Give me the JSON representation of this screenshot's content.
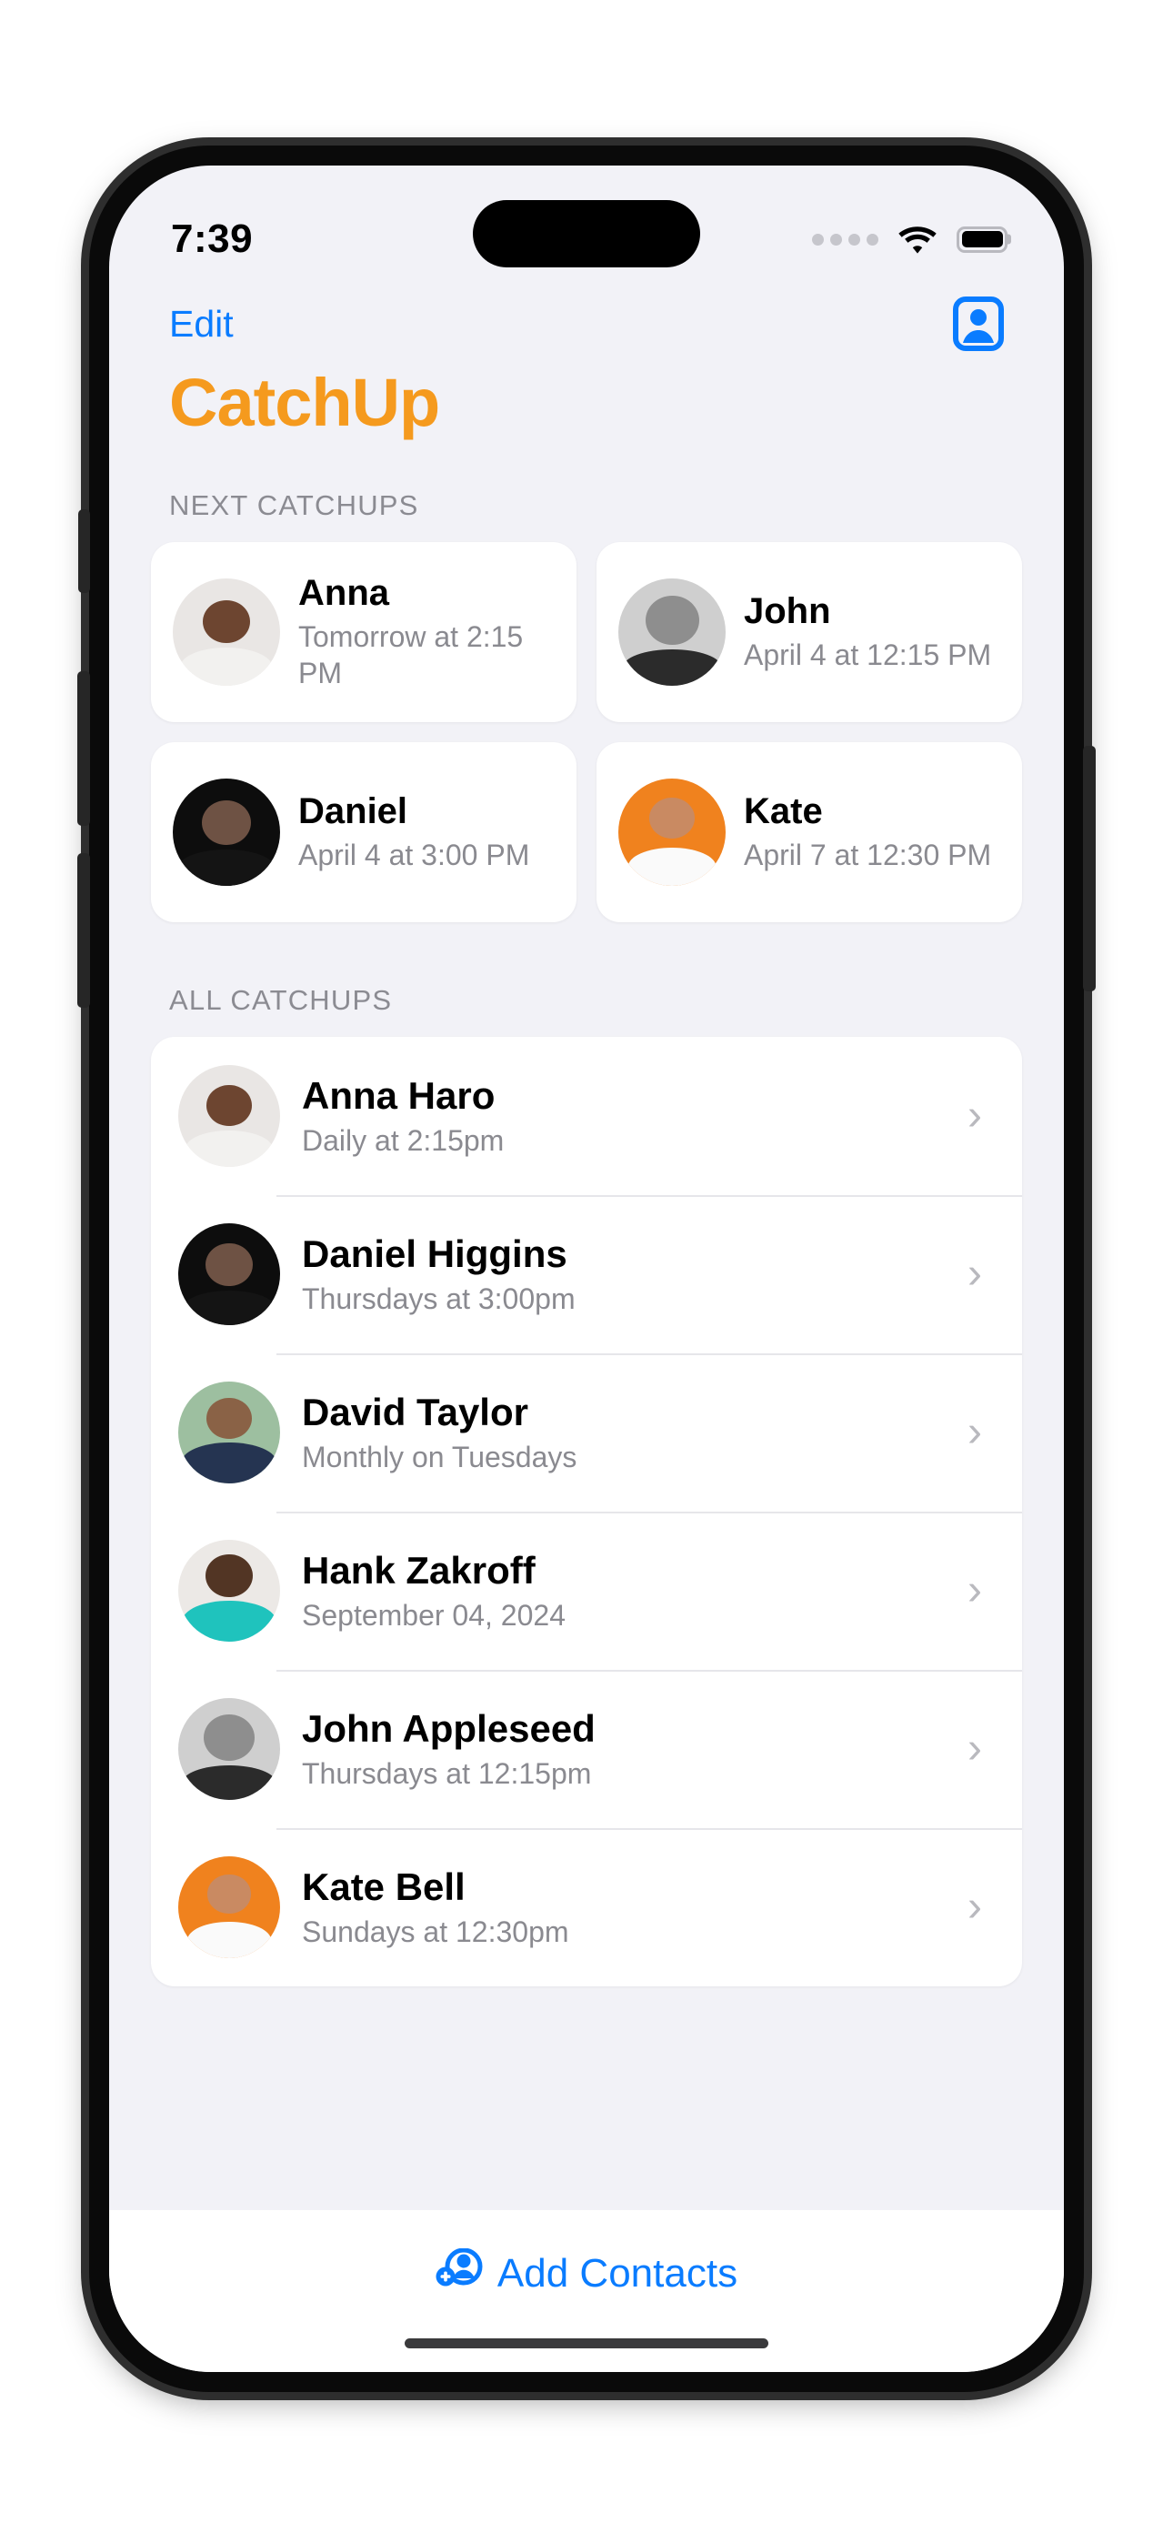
{
  "status_bar": {
    "time": "7:39",
    "cellular_icon": "cellular-dots-icon",
    "wifi_icon": "wifi-icon",
    "battery_icon": "battery-full-icon"
  },
  "nav": {
    "edit_label": "Edit",
    "contact_card_icon": "contact-card-icon"
  },
  "header": {
    "title": "CatchUp",
    "title_color": "#F59A1E"
  },
  "next_catchups": {
    "section_label": "NEXT CATCHUPS",
    "cards": [
      {
        "name": "Anna",
        "when": "Tomorrow at 2:15 PM",
        "avatar": "ph-anna"
      },
      {
        "name": "John",
        "when": "April 4 at 12:15 PM",
        "avatar": "ph-john"
      },
      {
        "name": "Daniel",
        "when": "April 4 at 3:00 PM",
        "avatar": "ph-daniel"
      },
      {
        "name": "Kate",
        "when": "April 7 at 12:30 PM",
        "avatar": "ph-kate"
      }
    ]
  },
  "all_catchups": {
    "section_label": "ALL CATCHUPS",
    "rows": [
      {
        "name": "Anna Haro",
        "schedule": "Daily at 2:15pm",
        "avatar": "ph-anna",
        "chevron": "chevron-right-icon"
      },
      {
        "name": "Daniel Higgins",
        "schedule": "Thursdays at 3:00pm",
        "avatar": "ph-daniel",
        "chevron": "chevron-right-icon"
      },
      {
        "name": "David Taylor",
        "schedule": "Monthly on Tuesdays",
        "avatar": "ph-david",
        "chevron": "chevron-right-icon"
      },
      {
        "name": "Hank Zakroff",
        "schedule": "September 04, 2024",
        "avatar": "ph-hank",
        "chevron": "chevron-right-icon"
      },
      {
        "name": "John Appleseed",
        "schedule": "Thursdays at 12:15pm",
        "avatar": "ph-john",
        "chevron": "chevron-right-icon"
      },
      {
        "name": "Kate Bell",
        "schedule": "Sundays at 12:30pm",
        "avatar": "ph-kate",
        "chevron": "chevron-right-icon"
      }
    ]
  },
  "toolbar": {
    "add_contacts_label": "Add Contacts",
    "add_contacts_icon": "person-badge-plus-icon"
  },
  "colors": {
    "accent_blue": "#0a7cff",
    "brand_orange": "#F59A1E",
    "background": "#F2F2F7",
    "card": "#FFFFFF",
    "secondary_text": "#8a8a90"
  }
}
